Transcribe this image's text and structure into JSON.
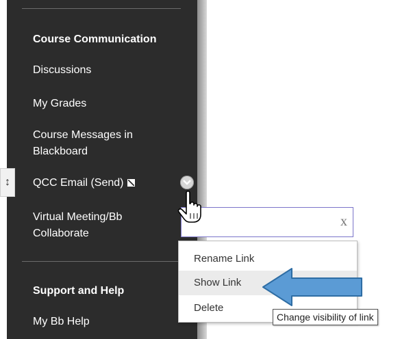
{
  "sidebar": {
    "section_heading": "Course Communication",
    "items": [
      {
        "label": "Discussions"
      },
      {
        "label": "My Grades"
      },
      {
        "label": "Course Messages in"
      },
      {
        "label": "Blackboard"
      },
      {
        "label": "QCC Email (Send)"
      },
      {
        "label": "Virtual Meeting/Bb"
      },
      {
        "label": "Collaborate"
      }
    ],
    "support_heading": "Support and Help",
    "support_items": [
      {
        "label": "My Bb Help"
      }
    ]
  },
  "rename_field": {
    "value": "",
    "clear_glyph": "x"
  },
  "context_menu": {
    "items": [
      {
        "label": "Rename Link"
      },
      {
        "label": "Show Link"
      },
      {
        "label": "Delete"
      }
    ]
  },
  "tooltip": "Change visibility of link",
  "colors": {
    "sidebar_bg": "#2c2c2c",
    "highlight_bg": "#ebebeb",
    "arrow_fill": "#5b9bd5",
    "field_border": "#7a73c9"
  },
  "icons": [
    "drag-handle-icon",
    "external-link-icon",
    "chevron-down-icon",
    "hand-cursor-icon",
    "blue-left-arrow-icon"
  ]
}
